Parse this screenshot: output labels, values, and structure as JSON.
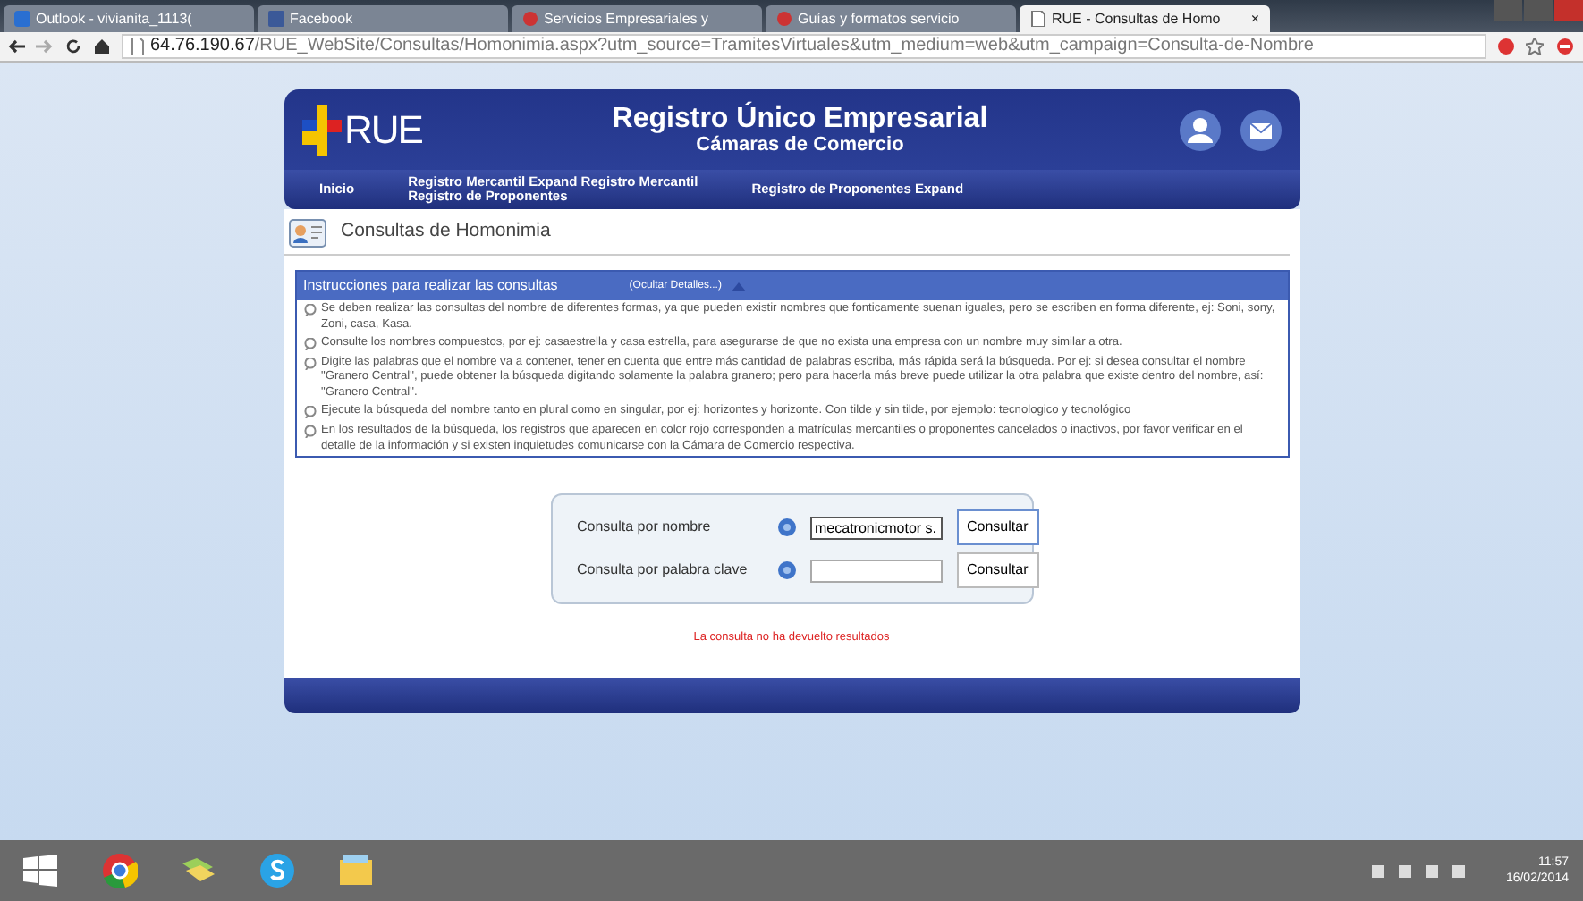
{
  "browser": {
    "tabs": [
      {
        "label": "Outlook - vivianita_1113(",
        "kind": "mail",
        "selected": false
      },
      {
        "label": "Facebook",
        "kind": "facebook",
        "selected": false
      },
      {
        "label": "Servicios Empresariales y",
        "kind": "page",
        "selected": false
      },
      {
        "label": "Guías y formatos servicio",
        "kind": "page",
        "selected": false
      },
      {
        "label": "RUE - Consultas de Homo",
        "kind": "doc",
        "selected": true
      }
    ],
    "close_tab": "×",
    "url_host": "64.76.190.67",
    "url_path": "/RUE_WebSite/Consultas/Homonimia.aspx?utm_source=TramitesVirtuales&utm_medium=web&utm_campaign=Consulta-de-Nombre"
  },
  "header": {
    "logo": "RUE",
    "title": "Registro Único Empresarial",
    "subtitle": "Cámaras de Comercio"
  },
  "nav": [
    {
      "label": "Inicio"
    },
    {
      "label": "Registro Mercantil Expand Registro Mercantil",
      "sub": "Registro de Proponentes"
    },
    {
      "label": "Registro de Proponentes Expand"
    }
  ],
  "page_title": "Consultas de Homonimia",
  "instructions": {
    "title": "Instrucciones para realizar las consultas",
    "toggle": "(Ocultar Detalles...)",
    "items": [
      "Se deben realizar las consultas del nombre de diferentes formas, ya que pueden existir nombres que fonticamente suenan iguales, pero se escriben en forma diferente, ej: Soni, sony, Zoni, casa, Kasa.",
      "Consulte los nombres compuestos, por ej: casaestrella y casa estrella, para asegurarse de que no exista una empresa con un nombre muy similar a otra.",
      "Digite las palabras que el nombre va a contener, tener en cuenta que entre más cantidad de palabras escriba, más rápida será la búsqueda. Por ej: si desea consultar el nombre \"Granero Central\", puede obtener la búsqueda digitando solamente la palabra granero; pero para hacerla más breve puede utilizar la otra palabra que existe dentro del nombre, así: \"Granero Central\".",
      "Ejecute la búsqueda del nombre tanto en plural como en singular, por ej: horizontes y horizonte. Con tilde y sin tilde, por ejemplo: tecnologico y tecnológico",
      "En los resultados de la búsqueda, los registros que aparecen en color rojo corresponden a matrículas mercantiles o proponentes cancelados o inactivos, por favor verificar en el detalle de la información y si existen inquietudes comunicarse con la Cámara de Comercio respectiva."
    ]
  },
  "search": [
    {
      "label": "Consulta por nombre",
      "value": "mecatronicmotor s.",
      "button": "Consultar",
      "focused": true
    },
    {
      "label": "Consulta por palabra clave",
      "button": "Consultar",
      "focused": false
    }
  ],
  "message": "La consulta no ha devuelto resultados",
  "taskbar": {
    "time": "11:57",
    "date": "16/02/2014"
  }
}
